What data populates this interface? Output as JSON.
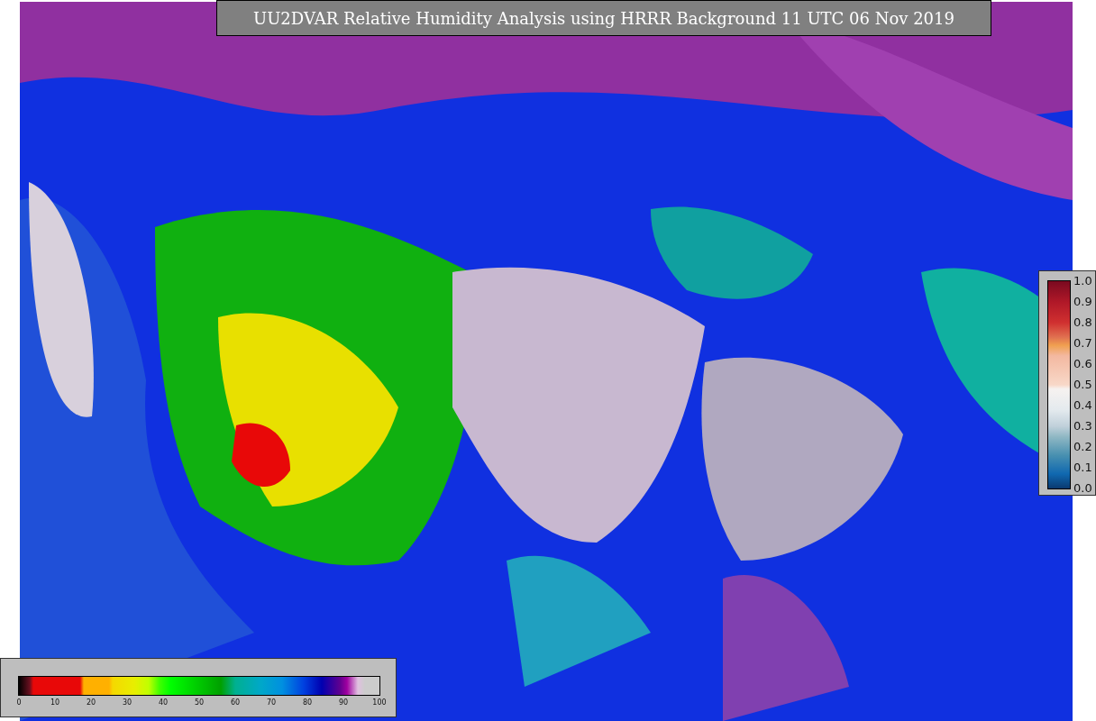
{
  "title": "UU2DVAR Relative Humidity Analysis using HRRR Background 11 UTC 06 Nov 2019",
  "humidity_colorbar": {
    "ticks": [
      "0",
      "10",
      "20",
      "30",
      "40",
      "50",
      "60",
      "70",
      "80",
      "90",
      "100"
    ]
  },
  "innovation_colorbar": {
    "ticks": [
      "1.0",
      "0.9",
      "0.8",
      "0.7",
      "0.6",
      "0.5",
      "0.4",
      "0.3",
      "0.2",
      "0.1",
      "0.0"
    ]
  }
}
